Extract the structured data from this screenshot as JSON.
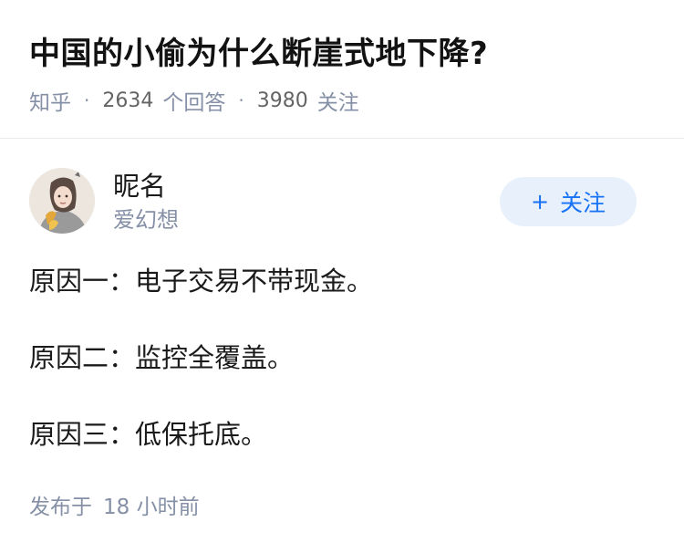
{
  "question": {
    "title": "中国的小偷为什么断崖式地下降?",
    "source": "知乎",
    "separator": "·",
    "answer_count": "2634",
    "answer_label": "个回答",
    "follower_count": "3980",
    "follower_label": "关注"
  },
  "author": {
    "name": "昵名",
    "bio": "爱幻想",
    "avatar_icon": "avatar-illustration-icon",
    "follow_label": "关注",
    "follow_prefix": "+"
  },
  "answer": {
    "paragraphs": [
      "原因一：电子交易不带现金。",
      "原因二：监控全覆盖。",
      "原因三：低保托底。"
    ],
    "publish_label": "发布于",
    "publish_time": "18 小时前"
  },
  "colors": {
    "accent": "#1772f6",
    "follow_bg": "#e8f0fb",
    "meta": "#8590a6",
    "text": "#1a1a1a"
  }
}
